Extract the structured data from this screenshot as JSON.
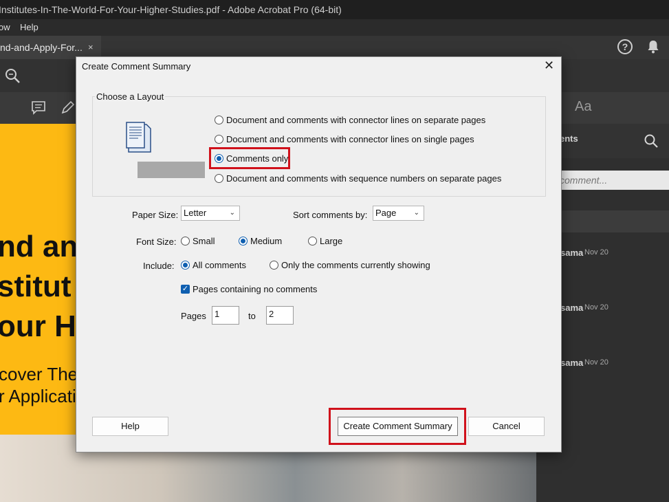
{
  "window": {
    "title": "Institutes-In-The-World-For-Your-Higher-Studies.pdf - Adobe Acrobat Pro (64-bit)"
  },
  "menu": {
    "items": [
      "ow",
      "Help"
    ]
  },
  "tab": {
    "label": "nd-and-Apply-For...",
    "close": "×"
  },
  "header_icons": {
    "help": "?"
  },
  "toolbar": {
    "font_tool": "Aa"
  },
  "document": {
    "lines_big": [
      "nd an",
      "stitut",
      "our Hi"
    ],
    "lines_mid": [
      "cover The I",
      "r Applicati"
    ]
  },
  "comments_panel": {
    "title": "ents",
    "search_placeholder": "comment...",
    "entries": [
      {
        "name": "sama",
        "date": "Nov 20"
      },
      {
        "name": "sama",
        "date": "Nov 20"
      },
      {
        "name": "sama",
        "date": "Nov 20"
      }
    ]
  },
  "dialog": {
    "title": "Create Comment Summary",
    "close": "✕",
    "layout_group_label": "Choose a Layout",
    "layout_options": [
      {
        "label": "Document and comments with connector lines on separate pages",
        "selected": false
      },
      {
        "label": "Document and comments with connector lines on single pages",
        "selected": false
      },
      {
        "label": "Comments only",
        "selected": true
      },
      {
        "label": "Document and comments with sequence numbers on separate pages",
        "selected": false
      }
    ],
    "paper_size": {
      "label": "Paper Size:",
      "value": "Letter"
    },
    "sort": {
      "label": "Sort comments by:",
      "value": "Page"
    },
    "font_size": {
      "label": "Font Size:",
      "options": [
        "Small",
        "Medium",
        "Large"
      ],
      "selected": "Medium"
    },
    "include": {
      "label": "Include:",
      "options": [
        "All comments",
        "Only the comments currently showing"
      ],
      "selected": "All comments"
    },
    "pages_no_comments": {
      "label": "Pages containing no comments",
      "checked": true
    },
    "pages": {
      "label": "Pages",
      "from": "1",
      "to_label": "to",
      "to": "2"
    },
    "buttons": {
      "help": "Help",
      "create": "Create Comment Summary",
      "cancel": "Cancel"
    }
  },
  "colors": {
    "accent": "#0f5fb0",
    "highlight": "#d0111b",
    "doc_yellow": "#fdb913"
  }
}
